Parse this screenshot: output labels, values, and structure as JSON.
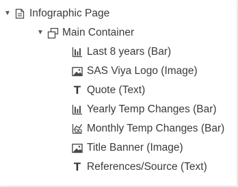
{
  "tree": {
    "root": {
      "label": "Infographic Page",
      "icon": "page-icon",
      "expanded": true
    },
    "container": {
      "label": "Main Container",
      "icon": "container-icon",
      "expanded": true
    },
    "children": [
      {
        "label": "Last 8 years (Bar)",
        "icon": "bar-chart-icon"
      },
      {
        "label": "SAS Viya Logo (Image)",
        "icon": "image-icon"
      },
      {
        "label": "Quote (Text)",
        "icon": "text-icon"
      },
      {
        "label": "Yearly Temp Changes (Bar)",
        "icon": "bar-chart-icon"
      },
      {
        "label": "Monthly Temp Changes (Bar)",
        "icon": "custom-chart-icon"
      },
      {
        "label": "Title Banner (Image)",
        "icon": "image-icon"
      },
      {
        "label": "References/Source (Text)",
        "icon": "text-icon"
      }
    ]
  },
  "colors": {
    "text": "#3a3a3a",
    "icon": "#4a4a4a"
  }
}
